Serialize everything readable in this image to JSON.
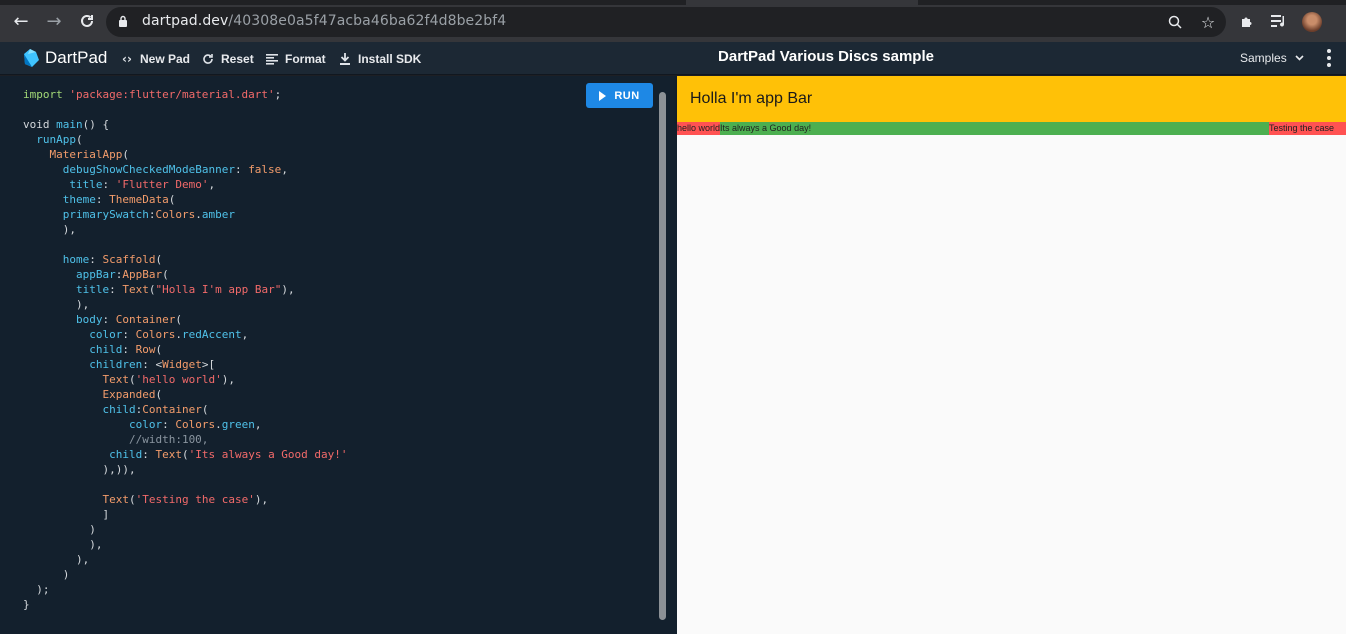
{
  "browser": {
    "url_host": "dartpad.dev",
    "url_path": "/40308e0a5f47acba46ba62f4d8be2bf4"
  },
  "header": {
    "app_name": "DartPad",
    "new_pad": "New Pad",
    "reset": "Reset",
    "format": "Format",
    "install_sdk": "Install SDK",
    "page_title": "DartPad Various Discs sample",
    "samples": "Samples"
  },
  "editor": {
    "run_label": "RUN",
    "code_lines": [
      "import 'package:flutter/material.dart';",
      "",
      "void main() {",
      "  runApp(",
      "    MaterialApp(",
      "      debugShowCheckedModeBanner: false,",
      "       title: 'Flutter Demo',",
      "      theme: ThemeData(",
      "      primarySwatch:Colors.amber",
      "      ),",
      "",
      "      home: Scaffold(",
      "        appBar:AppBar(",
      "        title: Text(\"Holla I'm app Bar\"),",
      "        ),",
      "        body: Container(",
      "          color: Colors.redAccent,",
      "          child: Row(",
      "          children: <Widget>[",
      "            Text('hello world'),",
      "            Expanded(",
      "            child:Container(",
      "                color: Colors.green,",
      "                //width:100,",
      "             child: Text('Its always a Good day!'",
      "            ),)),",
      "",
      "            Text('Testing the case'),",
      "            ]",
      "          )",
      "          ),",
      "        ),",
      "      )",
      "  );",
      "}"
    ]
  },
  "preview": {
    "appbar_title": "Holla I'm app Bar",
    "row_text_1": "hello world",
    "row_text_2": "Its always a Good day!",
    "row_text_3": "Testing the case",
    "colors": {
      "appbar": "#ffc107",
      "red_accent": "#ff5252",
      "green": "#4caf50"
    }
  }
}
